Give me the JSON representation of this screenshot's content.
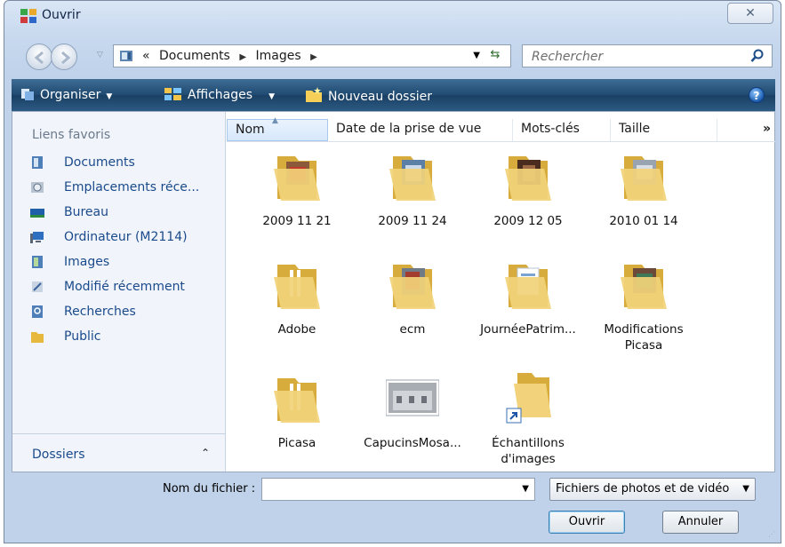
{
  "window": {
    "title": "Ouvrir",
    "close_label": "✕"
  },
  "address": {
    "prefix": "«",
    "crumbs": [
      "Documents",
      "Images"
    ],
    "search_placeholder": "Rechercher"
  },
  "toolbar": {
    "organiser": "Organiser",
    "affichages": "Affichages",
    "nouveau_dossier": "Nouveau dossier",
    "help": "?"
  },
  "sidebar": {
    "header": "Liens favoris",
    "items": [
      {
        "label": "Documents",
        "icon": "documents-icon"
      },
      {
        "label": "Emplacements réce...",
        "icon": "recent-places-icon"
      },
      {
        "label": "Bureau",
        "icon": "desktop-icon"
      },
      {
        "label": "Ordinateur (M2114)",
        "icon": "computer-icon"
      },
      {
        "label": "Images",
        "icon": "pictures-icon"
      },
      {
        "label": "Modifié récemment",
        "icon": "recently-changed-icon"
      },
      {
        "label": "Recherches",
        "icon": "searches-icon"
      },
      {
        "label": "Public",
        "icon": "public-folder-icon"
      }
    ],
    "dossiers_label": "Dossiers",
    "dossiers_chevron": "⌃"
  },
  "columns": {
    "nom": "Nom",
    "date": "Date de la prise de vue",
    "mots_cles": "Mots-clés",
    "taille": "Taille",
    "more": "»"
  },
  "files": [
    {
      "name": "2009 11 21",
      "type": "photo-folder"
    },
    {
      "name": "2009 11 24",
      "type": "photo-folder"
    },
    {
      "name": "2009 12 05",
      "type": "photo-folder"
    },
    {
      "name": "2010 01 14",
      "type": "photo-folder"
    },
    {
      "name": "Adobe",
      "type": "folder"
    },
    {
      "name": "ecm",
      "type": "photo-folder"
    },
    {
      "name": "JournéePatrim...",
      "type": "doc-folder"
    },
    {
      "name": "Modifications Picasa",
      "type": "photo-folder"
    },
    {
      "name": "Picasa",
      "type": "folder"
    },
    {
      "name": "CapucinsMosa...",
      "type": "image-file"
    },
    {
      "name": "Échantillons d'images",
      "type": "shortcut-folder"
    }
  ],
  "bottom": {
    "filename_label": "Nom du fichier :",
    "filename_value": "",
    "filetype_value": "Fichiers de photos et de vidéo",
    "open_label": "Ouvrir",
    "cancel_label": "Annuler"
  },
  "colors": {
    "toolbar": "#1f4a72",
    "link": "#1a4a8b",
    "folder": "#f2d27a"
  }
}
